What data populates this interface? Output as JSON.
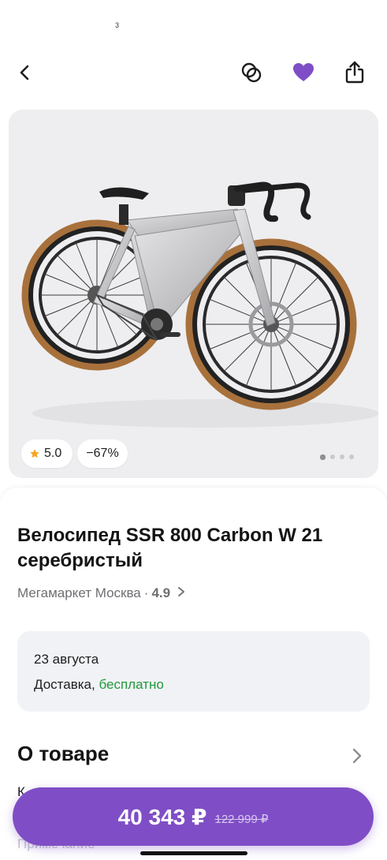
{
  "status": {
    "text": "3"
  },
  "topbar": {
    "icons": [
      "chevron-left-icon",
      "compare-icon",
      "heart-icon",
      "share-icon"
    ],
    "favorite_color": "#7f4ec6"
  },
  "gallery": {
    "rating": "5.0",
    "discount": "−67%",
    "image_count": 4,
    "active_index": 0,
    "star_color": "#f5a623"
  },
  "product": {
    "title": "Велосипед SSR 800 Carbon W 21 серебристый",
    "seller_name": "Мегамаркет Москва",
    "seller_sep": "·",
    "seller_rating": "4.9"
  },
  "delivery": {
    "date": "23 августа",
    "label": "Доставка,",
    "free_text": "бесплатно",
    "free_color": "#1f9a3a"
  },
  "about": {
    "title": "О товаре",
    "row_partial": "К",
    "row_partial2": "Примечание"
  },
  "buy": {
    "price": "40 343 ₽",
    "old_price": "122 999 ₽",
    "color": "#7f4ec6"
  }
}
